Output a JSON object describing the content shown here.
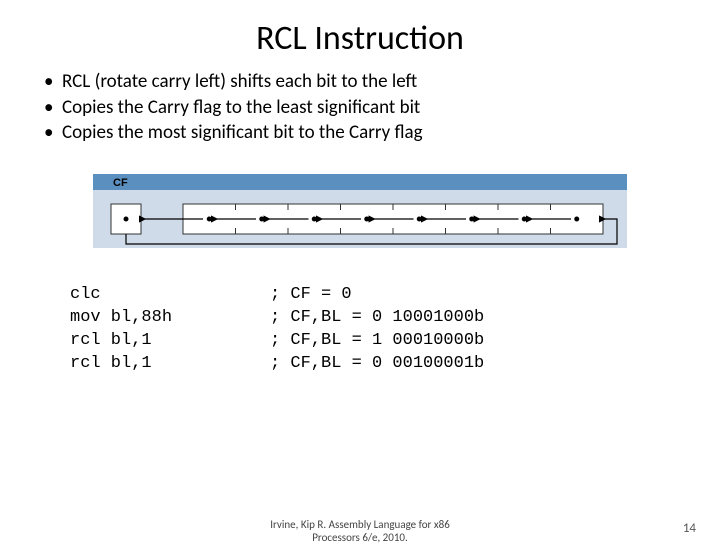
{
  "title": "RCL Instruction",
  "bullets": [
    "RCL (rotate carry left) shifts each bit to the left",
    "Copies the Carry flag to the least significant bit",
    "Copies the most significant bit to the Carry flag"
  ],
  "diagram": {
    "cf_label": "CF",
    "bit_count": 8
  },
  "code": {
    "instructions": [
      "clc",
      "mov bl,88h",
      "rcl bl,1",
      "rcl bl,1"
    ],
    "comments": [
      "; CF = 0",
      "; CF,BL = 0 10001000b",
      "; CF,BL = 1 00010000b",
      "; CF,BL = 0 00100001b"
    ]
  },
  "footer": {
    "line1": "Irvine, Kip R. Assembly Language for x86",
    "line2": "Processors 6/e, 2010."
  },
  "page_number": "14"
}
